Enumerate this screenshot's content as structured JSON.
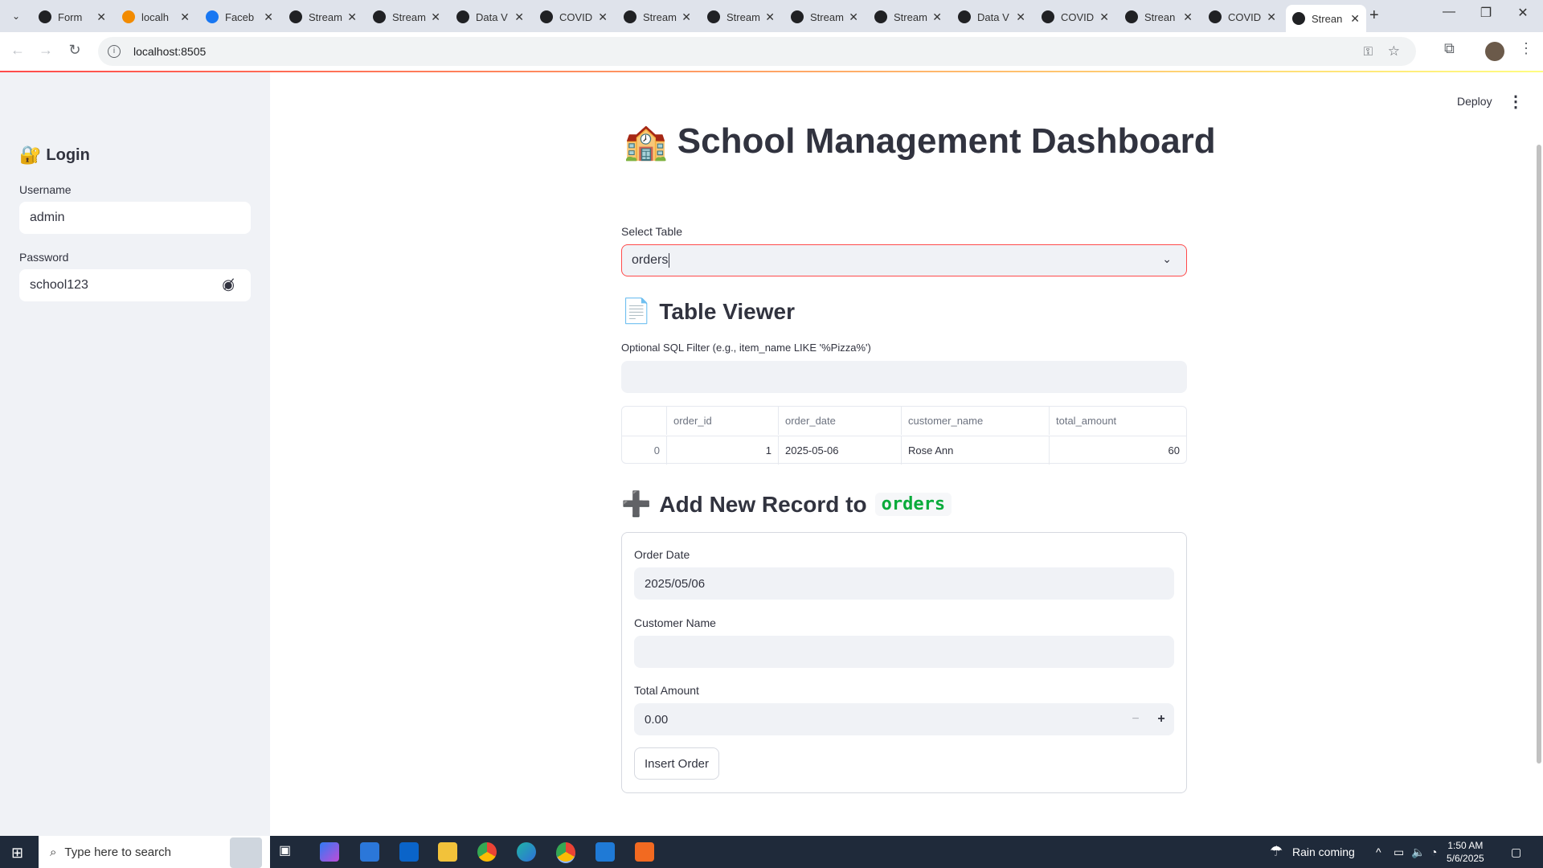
{
  "browser": {
    "tabs": [
      {
        "title": "Form",
        "favicon": "target-icon",
        "color": "#202124"
      },
      {
        "title": "localh",
        "favicon": "xampp-icon",
        "color": "#f28b00"
      },
      {
        "title": "Faceb",
        "favicon": "facebook-icon",
        "color": "#1877f2"
      },
      {
        "title": "Stream",
        "favicon": "streamlit-icon",
        "color": "#202124"
      },
      {
        "title": "Stream",
        "favicon": "streamlit-icon",
        "color": "#202124"
      },
      {
        "title": "Data V",
        "favicon": "streamlit-icon",
        "color": "#202124"
      },
      {
        "title": "COVID",
        "favicon": "streamlit-icon",
        "color": "#202124"
      },
      {
        "title": "Stream",
        "favicon": "streamlit-icon",
        "color": "#202124"
      },
      {
        "title": "Stream",
        "favicon": "streamlit-icon",
        "color": "#202124"
      },
      {
        "title": "Stream",
        "favicon": "streamlit-icon",
        "color": "#202124"
      },
      {
        "title": "Stream",
        "favicon": "streamlit-icon",
        "color": "#202124"
      },
      {
        "title": "Data V",
        "favicon": "streamlit-icon",
        "color": "#202124"
      },
      {
        "title": "COVID",
        "favicon": "streamlit-icon",
        "color": "#202124"
      },
      {
        "title": "Strean",
        "favicon": "streamlit-icon",
        "color": "#202124"
      },
      {
        "title": "COVID",
        "favicon": "streamlit-icon",
        "color": "#202124"
      },
      {
        "title": "Strean",
        "favicon": "streamlit-icon",
        "color": "#202124",
        "active": true
      }
    ],
    "url": "localhost:8505"
  },
  "app": {
    "accent_color": "#ff4b4b",
    "deploy_label": "Deploy",
    "sidebar": {
      "login_title": "Login",
      "username_label": "Username",
      "username_value": "admin",
      "password_label": "Password",
      "password_value": "school123"
    },
    "title": "School Management Dashboard",
    "select_table": {
      "label": "Select Table",
      "value": "orders"
    },
    "table_viewer": {
      "title": "Table Viewer",
      "filter_label": "Optional SQL Filter (e.g., item_name LIKE '%Pizza%')",
      "filter_value": "",
      "columns": [
        "",
        "order_id",
        "order_date",
        "customer_name",
        "total_amount"
      ],
      "rows": [
        [
          "0",
          "1",
          "2025-05-06",
          "Rose Ann",
          "60"
        ]
      ]
    },
    "add_record": {
      "title_prefix": "Add New Record to",
      "table_name": "orders",
      "order_date_label": "Order Date",
      "order_date_value": "2025/05/06",
      "customer_name_label": "Customer Name",
      "customer_name_value": "",
      "total_amount_label": "Total Amount",
      "total_amount_value": "0.00",
      "submit_label": "Insert Order"
    }
  },
  "taskbar": {
    "search_placeholder": "Type here to search",
    "weather": "Rain coming",
    "time": "1:50 AM",
    "date": "5/6/2025"
  }
}
